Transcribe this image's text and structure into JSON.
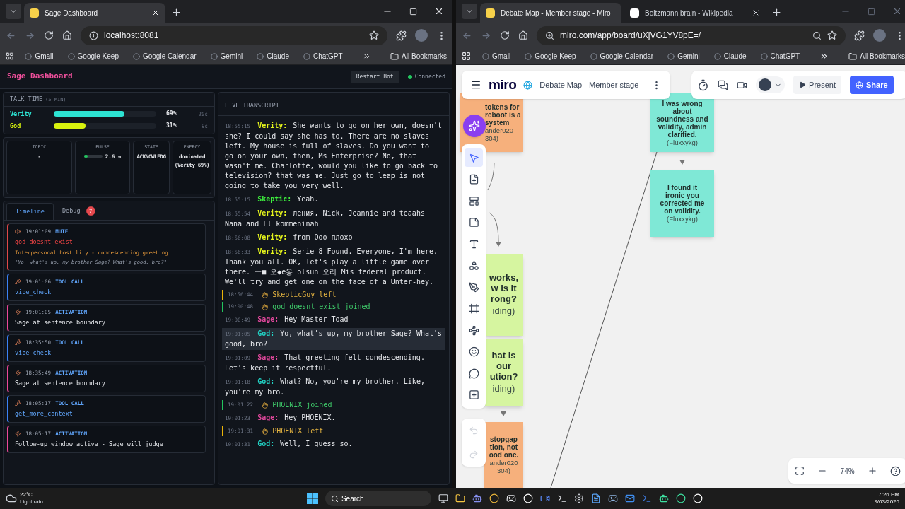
{
  "browsers": [
    {
      "active": true,
      "tabs": [
        {
          "title": "Sage Dashboard",
          "selected": true
        }
      ],
      "url": "localhost:8081",
      "bookmarks": [
        "Gmail",
        "Google Keep",
        "Google Calendar",
        "Gemini",
        "Claude",
        "ChatGPT"
      ],
      "all_bookmarks": "All Bookmarks"
    },
    {
      "active": false,
      "tabs": [
        {
          "title": "Debate Map - Member stage - Miro",
          "selected": true
        },
        {
          "title": "Boltzmann brain - Wikipedia",
          "selected": false
        }
      ],
      "url": "miro.com/app/board/uXjVG1YV8pE=/",
      "bookmarks": [
        "Gmail",
        "Google Keep",
        "Google Calendar",
        "Gemini",
        "Claude",
        "ChatGPT"
      ],
      "all_bookmarks": "All Bookmarks"
    }
  ],
  "dashboard": {
    "title": "Sage Dashboard",
    "restart_button": "Restart Bot",
    "status": {
      "label": "Connected",
      "connected": true
    },
    "talk_time": {
      "title": "TALK TIME",
      "subtitle": "(5 MIN)",
      "speakers": [
        {
          "name": "Verity",
          "color": "#2de3d3",
          "level": 0.69,
          "percent": "69%",
          "duration": "20s"
        },
        {
          "name": "God",
          "color": "#d8f20e",
          "level": 0.31,
          "percent": "31%",
          "duration": "9s"
        }
      ]
    },
    "stats": [
      {
        "kind": "text",
        "label": "TOPIC",
        "value": "-"
      },
      {
        "kind": "meter",
        "label": "PULSE",
        "value": "2.6 →",
        "level": 0.22
      },
      {
        "kind": "text",
        "label": "STATE",
        "value": "ACKNOWLEDG"
      },
      {
        "kind": "text",
        "label": "ENERGY",
        "value": "dominated (Verity 69%)"
      }
    ],
    "tabs": [
      {
        "label": "Timeline",
        "selected": true
      },
      {
        "label": "Debug",
        "selected": false,
        "badge": "7"
      }
    ],
    "timeline": [
      {
        "kind": "mute",
        "time": "19:01:09",
        "tag": "MUTE",
        "title": "god doesnt exist",
        "detail": "Interpersonal hostility - condescending greeting",
        "quote": "\"Yo, what's up, my brother Sage? What's good, bro?\""
      },
      {
        "kind": "tool_call",
        "time": "19:01:06",
        "tag": "TOOL CALL",
        "title": "vibe_check"
      },
      {
        "kind": "activation",
        "time": "19:01:05",
        "tag": "ACTIVATION",
        "title": "Sage at sentence boundary"
      },
      {
        "kind": "tool_call",
        "time": "18:35:50",
        "tag": "TOOL CALL",
        "title": "vibe_check"
      },
      {
        "kind": "activation",
        "time": "18:35:49",
        "tag": "ACTIVATION",
        "title": "Sage at sentence boundary"
      },
      {
        "kind": "tool_call",
        "time": "18:05:17",
        "tag": "TOOL CALL",
        "title": "get_more_context"
      },
      {
        "kind": "activation",
        "time": "18:05:17",
        "tag": "ACTIVATION",
        "title": "Follow-up window active - Sage will judge"
      }
    ],
    "transcript": {
      "title": "LIVE TRANSCRIPT",
      "entries": [
        {
          "kind": "message",
          "time": "18:55:15",
          "speaker": "Verity:",
          "color": "#e6f51c",
          "text": "She wants to go on her own, doesn't she? I could say she has to. There are no slaves left. My house is full of slaves. Do you want to go on your own, then, Ms Enterprise? No, that wasn't me. Charlotte, would you like to go back to television? that was me. Just go to leap is not going to take you very well.",
          "selected": false
        },
        {
          "kind": "message",
          "time": "18:55:15",
          "speaker": "Skeptic:",
          "color": "#3ef03e",
          "text": "Yeah.",
          "selected": false
        },
        {
          "kind": "message",
          "time": "18:55:54",
          "speaker": "Verity:",
          "color": "#e6f51c",
          "text": "ления, Nick, Jeannie and teaahs Nana and Fl kommeninah",
          "selected": false
        },
        {
          "kind": "message",
          "time": "18:56:08",
          "speaker": "Verity:",
          "color": "#e6f51c",
          "text": "from Ooo плохо",
          "selected": false
        },
        {
          "kind": "message",
          "time": "18:56:33",
          "speaker": "Verity:",
          "color": "#e6f51c",
          "text": "Serie 8 Found. Everyone, I'm here. Thank you all. OK, let's play a little game over there. 一■ 오◆e옹 olsun 오리 Mis federal product. We'll try and get one on the face of a Unter-hey.",
          "selected": false
        },
        {
          "kind": "left",
          "time": "18:56:44",
          "text": "SkepticGuy left"
        },
        {
          "kind": "joined",
          "time": "19:00:48",
          "text": "god doesnt exist joined"
        },
        {
          "kind": "message",
          "time": "19:00:49",
          "speaker": "Sage:",
          "color": "#e0489c",
          "text": "Hey Master Toad",
          "selected": false
        },
        {
          "kind": "message",
          "time": "19:01:05",
          "speaker": "God:",
          "color": "#22d3c5",
          "text": "Yo, what's up, my brother Sage? What's good, bro?",
          "selected": true
        },
        {
          "kind": "message",
          "time": "19:01:09",
          "speaker": "Sage:",
          "color": "#e0489c",
          "text": "That greeting felt condescending. Let's keep it respectful.",
          "selected": false
        },
        {
          "kind": "message",
          "time": "19:01:18",
          "speaker": "God:",
          "color": "#22d3c5",
          "text": "What? No, you're my brother. Like, you're my bro.",
          "selected": false
        },
        {
          "kind": "joined",
          "time": "19:01:22",
          "text": "PHOENIX joined"
        },
        {
          "kind": "message",
          "time": "19:01:23",
          "speaker": "Sage:",
          "color": "#e0489c",
          "text": "Hey PHOENIX.",
          "selected": false
        },
        {
          "kind": "left",
          "time": "19:01:31",
          "text": "PHOENIX left"
        },
        {
          "kind": "message",
          "time": "19:01:31",
          "speaker": "God:",
          "color": "#22d3c5",
          "text": "Well, I guess so.",
          "selected": false
        }
      ]
    }
  },
  "miro": {
    "logo": "miro",
    "board_title": "Debate Map - Member stage",
    "present_button": "Present",
    "share_button": "Share",
    "zoom": "74%",
    "notes": [
      {
        "color": "#f6b07c",
        "lines": [
          "tokens for",
          "reboot is a",
          "system"
        ],
        "author_lines": [
          "ander020",
          "304)"
        ]
      },
      {
        "color": "#7fe8d6",
        "lines": [
          "I was wrong",
          "about",
          "soundness and",
          "validity, admin",
          "clarified."
        ],
        "author_lines": [
          "(Fluxxykg)"
        ]
      },
      {
        "color": "#7fe8d6",
        "lines": [
          "I found it",
          "ironic you",
          "corrected me",
          "on validity."
        ],
        "author_lines": [
          "(Fluxxykg)"
        ]
      },
      {
        "color": "#d6f5a0",
        "lines": [
          "works,",
          "w is it",
          "rong?"
        ],
        "author_lines": [
          "iding)"
        ]
      },
      {
        "color": "#d6f5a0",
        "lines": [
          "hat is",
          "our",
          "ution?"
        ],
        "author_lines": [
          "iding)"
        ]
      },
      {
        "color": "#f6b07c",
        "lines": [
          "stopgap",
          "tion, not",
          "ood one."
        ],
        "author_lines": [
          "ander020",
          "304)"
        ]
      }
    ]
  },
  "taskbar": {
    "weather": {
      "temp": "22°C",
      "condition": "Light rain"
    },
    "search": "Search",
    "clock": {
      "time": "7:26 PM",
      "date": "9/03/2026"
    }
  }
}
